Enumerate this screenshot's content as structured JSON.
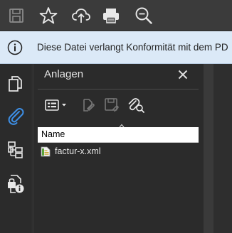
{
  "toolbar": {
    "buttons": [
      {
        "icon": "save-icon",
        "enabled": false
      },
      {
        "icon": "star-icon",
        "enabled": true
      },
      {
        "icon": "cloud-upload-icon",
        "enabled": true
      },
      {
        "icon": "print-icon",
        "enabled": true
      },
      {
        "icon": "search-zoom-icon",
        "enabled": true
      }
    ]
  },
  "infobar": {
    "icon": "info-icon",
    "message": "Diese Datei verlangt Konformität mit dem PD"
  },
  "rail": {
    "items": [
      {
        "icon": "pages-icon",
        "active": false
      },
      {
        "icon": "paperclip-icon",
        "active": true
      },
      {
        "icon": "structure-tree-icon",
        "active": false
      },
      {
        "icon": "document-lock-info-icon",
        "active": false
      }
    ]
  },
  "panel": {
    "title": "Anlagen",
    "close_icon": "close-icon",
    "tools": [
      "options-menu-icon",
      "open-attachment-icon",
      "save-attachment-icon",
      "search-attachment-icon"
    ],
    "column_header": "Name",
    "files": [
      {
        "name": "factur-x.xml",
        "icon": "xml-file-icon"
      }
    ]
  },
  "colors": {
    "toolbar_bg": "#3b3b3b",
    "panel_bg": "#2b2b2b",
    "info_bg": "#dbe9f7",
    "accent": "#3d8fe6",
    "icon_color": "#e8e8e8",
    "disabled_icon": "#8a8a8a"
  }
}
